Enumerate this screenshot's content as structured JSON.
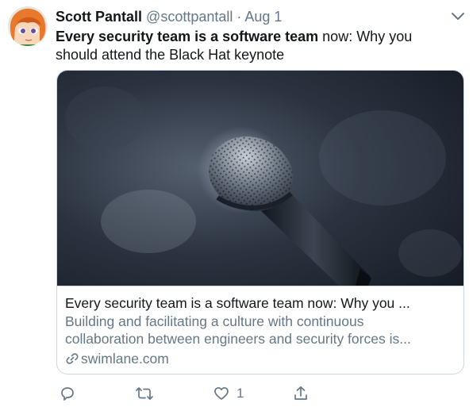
{
  "tweet": {
    "display_name": "Scott Pantall",
    "handle": "@scottpantall",
    "separator": "·",
    "date": "Aug 1",
    "text_bold": "Every security team is a software team",
    "text_rest": " now: Why you should attend the Black Hat keynote"
  },
  "card": {
    "title": "Every security team is a software team now: Why you ...",
    "description_line1": "Building and facilitating a culture with continuous",
    "description_line2": "collaboration between engineers and security forces is...",
    "domain": "swimlane.com",
    "image_subject": "microphone"
  },
  "actions": {
    "reply_icon": "reply-icon",
    "retweet_icon": "retweet-icon",
    "like_icon": "heart-icon",
    "like_count": "1",
    "share_icon": "share-icon"
  },
  "colors": {
    "text": "#14171a",
    "muted": "#657786",
    "border": "#ccd6dd"
  }
}
